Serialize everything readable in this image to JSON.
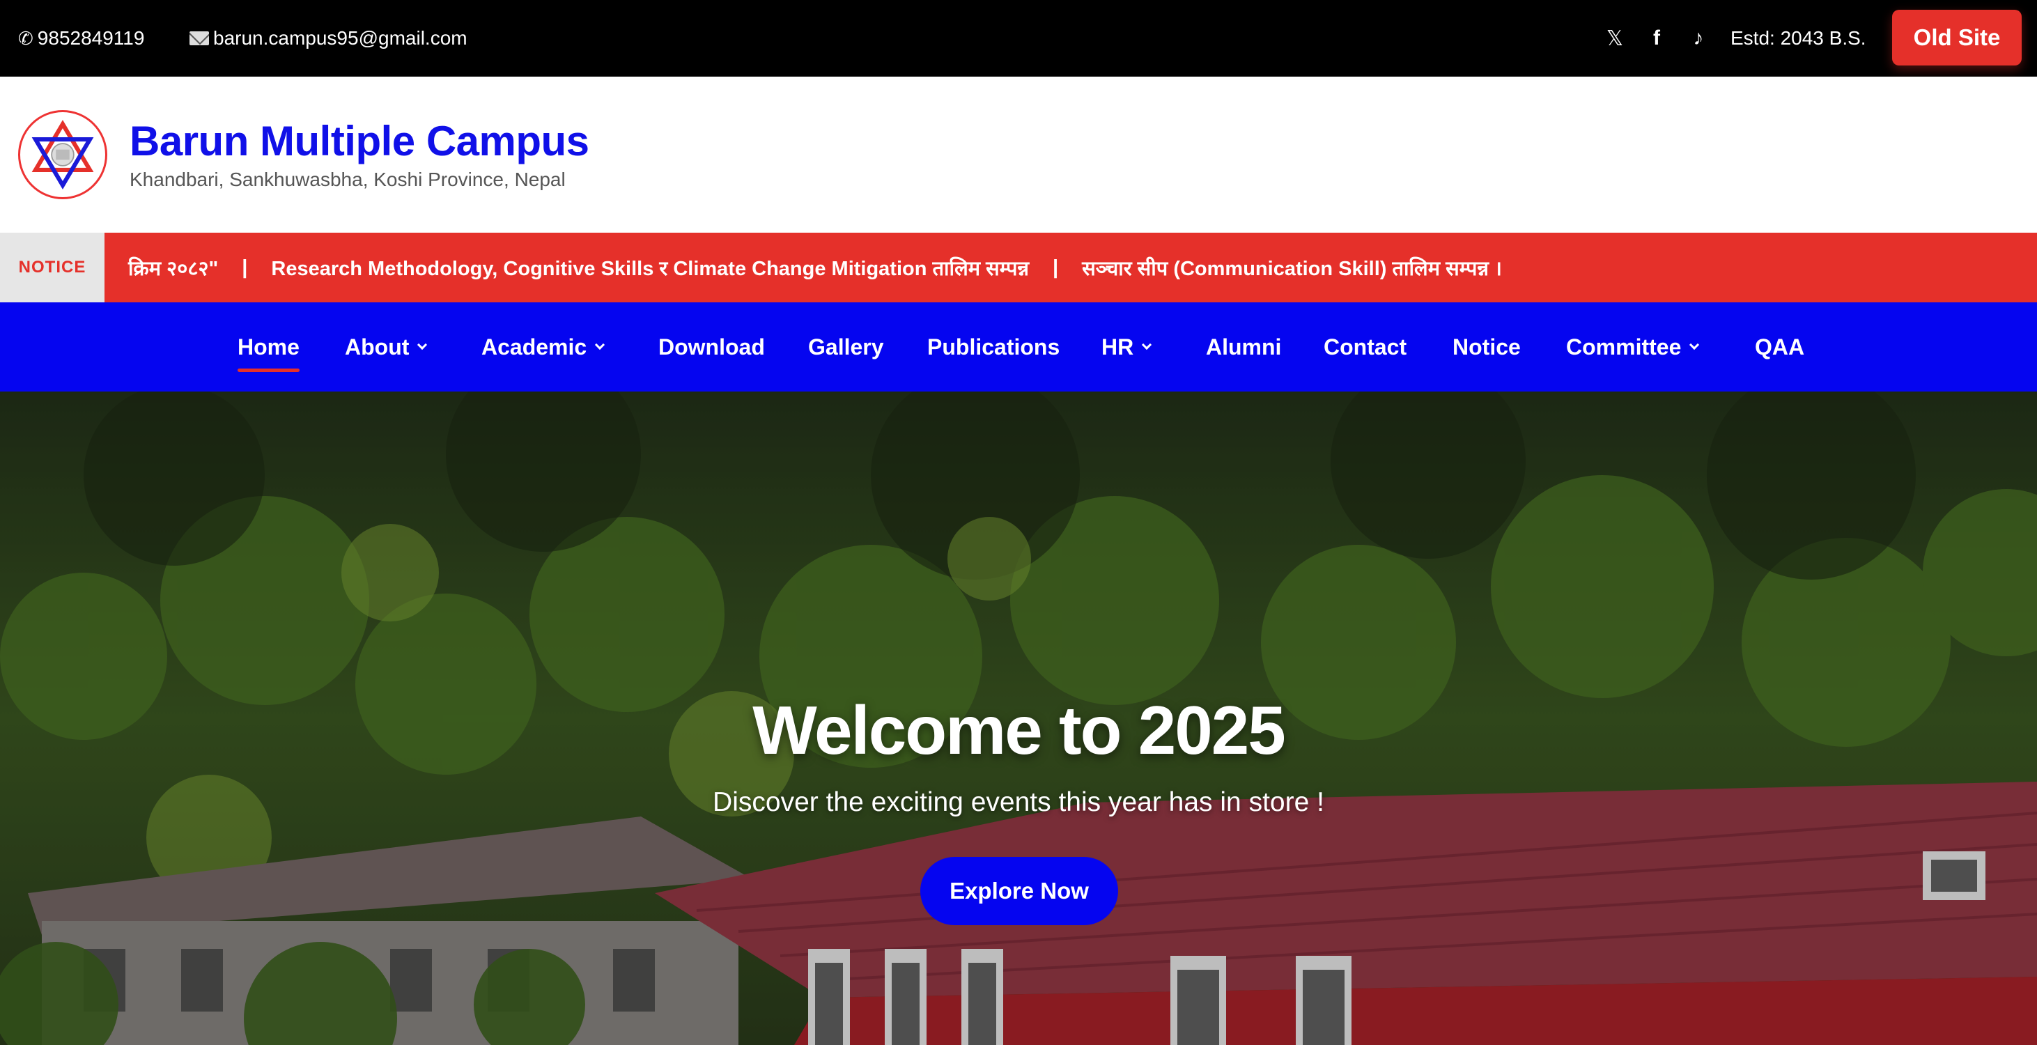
{
  "topbar": {
    "phone": "9852849119",
    "phone_icon": "phone-icon",
    "email": "barun.campus95@gmail.com",
    "email_icon": "mail-icon",
    "social": [
      {
        "name": "x-icon",
        "glyph": "𝕏"
      },
      {
        "name": "facebook-icon",
        "glyph": "f"
      },
      {
        "name": "tiktok-icon",
        "glyph": "♪"
      }
    ],
    "estd": "Estd: 2043 B.S.",
    "old_site_label": "Old Site"
  },
  "header": {
    "title": "Barun Multiple Campus",
    "subtitle": "Khandbari, Sankhuwasbha, Koshi Province, Nepal"
  },
  "notice": {
    "label": "NOTICE",
    "items": [
      "क्रिम २०८२\"",
      "Research Methodology, Cognitive Skills र Climate Change Mitigation तालिम सम्पन्न",
      "सञ्चार सीप (Communication Skill) तालिम सम्पन्न ।"
    ],
    "separator": "|"
  },
  "nav": {
    "items": [
      {
        "label": "Home",
        "active": true,
        "dropdown": false
      },
      {
        "label": "About",
        "active": false,
        "dropdown": true
      },
      {
        "label": "Academic",
        "active": false,
        "dropdown": true
      },
      {
        "label": "Download",
        "active": false,
        "dropdown": false
      },
      {
        "label": "Gallery",
        "active": false,
        "dropdown": false
      },
      {
        "label": "Publications",
        "active": false,
        "dropdown": false
      },
      {
        "label": "HR",
        "active": false,
        "dropdown": true
      },
      {
        "label": "Alumni",
        "active": false,
        "dropdown": false
      },
      {
        "label": "Contact",
        "active": false,
        "dropdown": false
      },
      {
        "label": "Notice",
        "active": false,
        "dropdown": false
      },
      {
        "label": "Committee",
        "active": false,
        "dropdown": true
      },
      {
        "label": "QAA",
        "active": false,
        "dropdown": false
      }
    ]
  },
  "hero": {
    "title": "Welcome to 2025",
    "subtitle": "Discover the exciting events this year has in store !",
    "button_label": "Explore Now"
  },
  "colors": {
    "brand_blue": "#0505f0",
    "accent_red": "#e5302a",
    "topbar_bg": "#000000"
  }
}
